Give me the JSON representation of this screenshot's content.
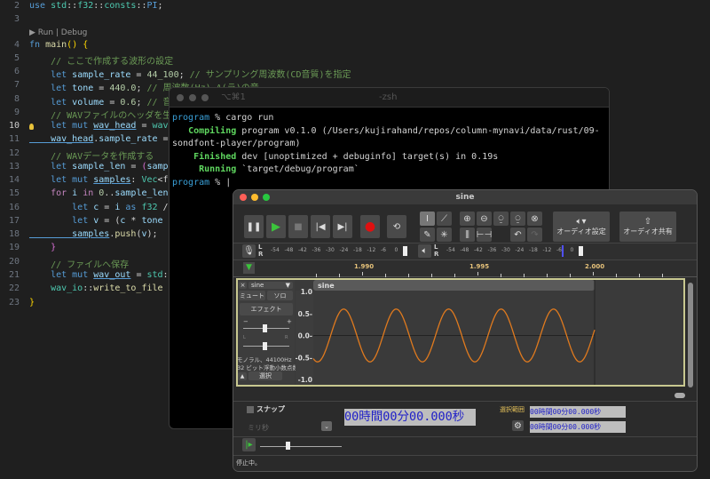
{
  "editor": {
    "codelens": "▶ Run | Debug",
    "lines": [
      {
        "n": "2",
        "tokens": [
          [
            "k",
            "use"
          ],
          [
            "p",
            " "
          ],
          [
            "t",
            "std"
          ],
          [
            "p",
            "::"
          ],
          [
            "t",
            "f32"
          ],
          [
            "p",
            "::"
          ],
          [
            "t",
            "consts"
          ],
          [
            "p",
            "::"
          ],
          [
            "k",
            "PI"
          ],
          [
            "p",
            ";"
          ]
        ]
      },
      {
        "n": "3",
        "tokens": []
      },
      {
        "n": "4",
        "tokens": [
          [
            "k",
            "fn"
          ],
          [
            "p",
            " "
          ],
          [
            "f",
            "main"
          ],
          [
            "b",
            "()"
          ],
          [
            "p",
            " "
          ],
          [
            "b",
            "{"
          ]
        ]
      },
      {
        "n": "5",
        "tokens": [
          [
            "c",
            "    // ここで作成する波形の設定"
          ]
        ]
      },
      {
        "n": "6",
        "tokens": [
          [
            "k",
            "    let"
          ],
          [
            "v",
            " sample_rate"
          ],
          [
            "p",
            " = "
          ],
          [
            "n",
            "44_100"
          ],
          [
            "p",
            "; "
          ],
          [
            "c",
            "// サンプリング周波数(CD音質)を指定"
          ]
        ]
      },
      {
        "n": "7",
        "tokens": [
          [
            "k",
            "    let"
          ],
          [
            "v",
            " tone"
          ],
          [
            "p",
            " = "
          ],
          [
            "n",
            "440.0"
          ],
          [
            "p",
            "; "
          ],
          [
            "c",
            "// 周波数(Hz) A(ラ)の音"
          ]
        ]
      },
      {
        "n": "8",
        "tokens": [
          [
            "k",
            "    let"
          ],
          [
            "v",
            " volume"
          ],
          [
            "p",
            " = "
          ],
          [
            "n",
            "0.6"
          ],
          [
            "p",
            "; "
          ],
          [
            "c",
            "// 音量"
          ]
        ]
      },
      {
        "n": "9",
        "tokens": [
          [
            "c",
            "    // WAVファイルのヘッダを生成"
          ]
        ]
      },
      {
        "n": "10",
        "tokens": [
          [
            "k",
            "    let mut"
          ],
          [
            "p",
            " "
          ],
          [
            "vu",
            "wav_head"
          ],
          [
            "p",
            " = "
          ],
          [
            "t",
            "wav"
          ]
        ]
      },
      {
        "n": "11",
        "tokens": [
          [
            "vu",
            "    wav_head"
          ],
          [
            "p",
            "."
          ],
          [
            "v",
            "sample_rate"
          ],
          [
            "p",
            " ="
          ]
        ]
      },
      {
        "n": "12",
        "tokens": [
          [
            "c",
            "    // WAVデータを作成する"
          ]
        ]
      },
      {
        "n": "13",
        "tokens": [
          [
            "k",
            "    let"
          ],
          [
            "v",
            " sample_len"
          ],
          [
            "p",
            " = "
          ],
          [
            "bp",
            "("
          ],
          [
            "v",
            "samp"
          ]
        ]
      },
      {
        "n": "14",
        "tokens": [
          [
            "k",
            "    let mut"
          ],
          [
            "p",
            " "
          ],
          [
            "vu",
            "samples"
          ],
          [
            "p",
            ": "
          ],
          [
            "t",
            "Vec"
          ],
          [
            "p",
            "<f"
          ]
        ]
      },
      {
        "n": "15",
        "tokens": [
          [
            "kf",
            "    for"
          ],
          [
            "v",
            " i"
          ],
          [
            "kf",
            " in"
          ],
          [
            "n",
            " 0"
          ],
          [
            "p",
            ".."
          ],
          [
            "v",
            "sample_len"
          ]
        ]
      },
      {
        "n": "16",
        "tokens": [
          [
            "k",
            "        let"
          ],
          [
            "v",
            " c"
          ],
          [
            "p",
            " = "
          ],
          [
            "v",
            "i"
          ],
          [
            "k",
            " as"
          ],
          [
            "t",
            " f32"
          ],
          [
            "p",
            " /"
          ]
        ]
      },
      {
        "n": "17",
        "tokens": [
          [
            "k",
            "        let"
          ],
          [
            "v",
            " v"
          ],
          [
            "p",
            " = ("
          ],
          [
            "v",
            "c"
          ],
          [
            "p",
            " * "
          ],
          [
            "v",
            "tone"
          ]
        ]
      },
      {
        "n": "18",
        "tokens": [
          [
            "vu",
            "        samples"
          ],
          [
            "p",
            "."
          ],
          [
            "f",
            "push"
          ],
          [
            "p",
            "("
          ],
          [
            "v",
            "v"
          ],
          [
            "p",
            ");"
          ]
        ]
      },
      {
        "n": "19",
        "tokens": [
          [
            "bp",
            "    }"
          ]
        ]
      },
      {
        "n": "20",
        "tokens": [
          [
            "c",
            "    // ファイルへ保存"
          ]
        ]
      },
      {
        "n": "21",
        "tokens": [
          [
            "k",
            "    let mut"
          ],
          [
            "p",
            " "
          ],
          [
            "vu",
            "wav_out"
          ],
          [
            "p",
            " = "
          ],
          [
            "t",
            "std"
          ],
          [
            "p",
            ":"
          ]
        ]
      },
      {
        "n": "22",
        "tokens": [
          [
            "t",
            "    wav_io"
          ],
          [
            "p",
            "::"
          ],
          [
            "f",
            "write_to_file"
          ]
        ]
      },
      {
        "n": "23",
        "tokens": [
          [
            "b",
            "}"
          ]
        ]
      }
    ]
  },
  "terminal": {
    "tab": "⌥⌘1",
    "title": "-zsh",
    "lines": [
      [
        [
          "tc",
          "program"
        ],
        [
          "p",
          " % cargo run"
        ]
      ],
      [
        [
          "p",
          "   "
        ],
        [
          "tg",
          "Compiling"
        ],
        [
          "p",
          " program v0.1.0 (/Users/kujirahand/repos/column-mynavi/data/rust/09-"
        ]
      ],
      [
        [
          "p",
          "sondfont-player/program)"
        ]
      ],
      [
        [
          "p",
          "    "
        ],
        [
          "tg",
          "Finished"
        ],
        [
          "p",
          " dev [unoptimized + debuginfo] target(s) in 0.19s"
        ]
      ],
      [
        [
          "p",
          "     "
        ],
        [
          "tg",
          "Running"
        ],
        [
          "p",
          " `target/debug/program`"
        ]
      ],
      [
        [
          "tc",
          "program"
        ],
        [
          "p",
          " % |"
        ]
      ]
    ]
  },
  "audacity": {
    "title": "sine",
    "audio_setup": "オーディオ設定",
    "share_audio": "オーディオ共有",
    "meter_ticks": [
      "-54",
      "-48",
      "-42",
      "-36",
      "-30",
      "-24",
      "-18",
      "-12",
      "-6",
      "0"
    ],
    "meter_lr": [
      "L",
      "R"
    ],
    "ruler_ticks": [
      "1.990",
      "1.995",
      "2.000"
    ],
    "track": {
      "name": "sine",
      "mute": "ミュート",
      "solo": "ソロ",
      "effects": "エフェクト",
      "gain_minus": "−",
      "gain_plus": "+",
      "pan_l": "L",
      "pan_r": "R",
      "info1": "モノラル、44100Hz",
      "info2": "32 ビット浮動小数点数",
      "select": "選択",
      "clip_name": "sine"
    },
    "snap": "スナップ",
    "snap_unit": "ミリ秒",
    "time": "00時間00分00.000秒",
    "selection_label": "選択範囲",
    "sel_start": "00時間00分00.000秒",
    "sel_end": "00時間00分00.000秒",
    "status": "停止中。",
    "colors": {
      "wave": "#e07a1e",
      "record": "#e01010",
      "play": "#3cc43c"
    }
  },
  "chart_data": {
    "type": "line",
    "title": "sine",
    "y_ticks": [
      "1.0",
      "0.5-",
      "0.0-",
      "-0.5-",
      "-1.0"
    ],
    "ylim": [
      -1,
      1
    ],
    "x_ticks": [
      "1.990",
      "1.995",
      "2.000"
    ],
    "xlim": [
      1.9879,
      2.0
    ],
    "series": [
      {
        "frequency_hz": 440,
        "amplitude": 0.6,
        "sample_rate": 44100
      }
    ]
  }
}
